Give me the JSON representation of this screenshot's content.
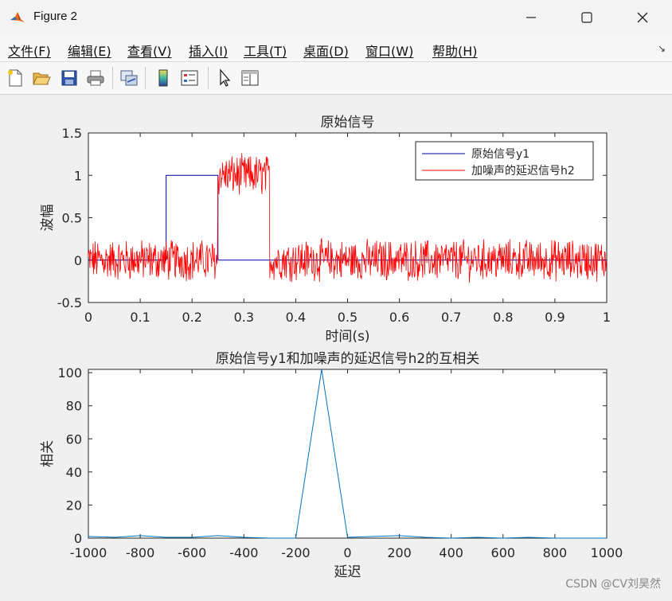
{
  "window": {
    "title": "Figure 2",
    "minimize_icon": "minimize-icon",
    "maximize_icon": "maximize-icon",
    "close_icon": "close-icon"
  },
  "menu": {
    "items": [
      "文件(F)",
      "编辑(E)",
      "查看(V)",
      "插入(I)",
      "工具(T)",
      "桌面(D)",
      "窗口(W)",
      "帮助(H)"
    ]
  },
  "toolbar": {
    "icons": [
      "new-figure-icon",
      "open-file-icon",
      "save-icon",
      "print-icon",
      "link-plot-icon",
      "colorbar-icon",
      "legend-icon",
      "select-cursor-icon",
      "property-inspector-icon"
    ]
  },
  "chart_data": [
    {
      "type": "line",
      "title": "原始信号",
      "xlabel": "时间(s)",
      "ylabel": "波幅",
      "xlim": [
        0,
        1
      ],
      "ylim": [
        -0.5,
        1.5
      ],
      "xticks": [
        "0",
        "0.1",
        "0.2",
        "0.3",
        "0.4",
        "0.5",
        "0.6",
        "0.7",
        "0.8",
        "0.9",
        "1"
      ],
      "yticks": [
        "-0.5",
        "0",
        "0.5",
        "1",
        "1.5"
      ],
      "legend": "top-right",
      "series": [
        {
          "name": "原始信号y1",
          "color": "#0000aa",
          "x": [
            0,
            0.15,
            0.15,
            0.25,
            0.25,
            1
          ],
          "y": [
            0,
            0,
            1,
            1,
            0,
            0
          ]
        },
        {
          "name": "加噪声的延迟信号h2",
          "color": "#ff0000",
          "pulse_start": 0.25,
          "pulse_end": 0.35,
          "pulse_level": 1,
          "noise": "approx. uniform ±0.2 around the level"
        }
      ]
    },
    {
      "type": "line",
      "title": "原始信号y1和加噪声的延迟信号h2的互相关",
      "xlabel": "延迟",
      "ylabel": "相关",
      "xlim": [
        -1000,
        1000
      ],
      "ylim": [
        0,
        102
      ],
      "xticks": [
        "-1000",
        "-800",
        "-600",
        "-400",
        "-200",
        "0",
        "200",
        "400",
        "600",
        "800",
        "1000"
      ],
      "yticks": [
        "0",
        "20",
        "40",
        "60",
        "80",
        "100"
      ],
      "series": [
        {
          "name": "",
          "color": "#0072bd",
          "x": [
            -1000,
            -900,
            -800,
            -700,
            -600,
            -500,
            -400,
            -300,
            -200,
            -100,
            0,
            100,
            200,
            300,
            400,
            500,
            600,
            700,
            800,
            900,
            1000
          ],
          "y": [
            1,
            0.5,
            1.5,
            0.5,
            0.5,
            1.5,
            0.5,
            0,
            0,
            102,
            0.5,
            1,
            1.5,
            0.5,
            0,
            0.5,
            0,
            0.5,
            0,
            0,
            0
          ]
        }
      ]
    }
  ],
  "watermark": "CSDN @CV刘昊然"
}
